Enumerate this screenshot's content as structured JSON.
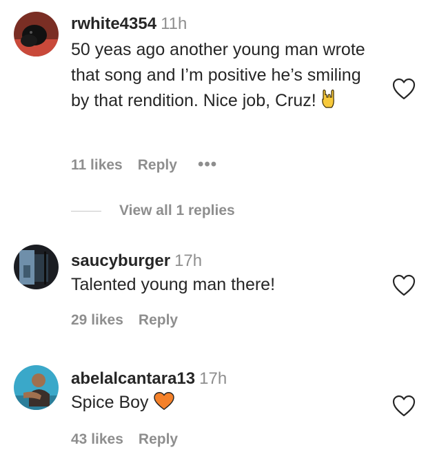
{
  "comments": [
    {
      "username": "rwhite4354",
      "time": "11h",
      "text": "50 yeas ago another young man wrote that song and I’m positive he’s smiling by that rendition. Nice job, Cruz!",
      "emoji_icon": "rock-hand-emoji-icon",
      "likes": "11 likes",
      "reply": "Reply",
      "more": "•••"
    },
    {
      "username": "saucyburger",
      "time": "17h",
      "text": "Talented young man there!",
      "likes": "29 likes",
      "reply": "Reply"
    },
    {
      "username": "abelalcantara13",
      "time": "17h",
      "text": "Spice Boy",
      "emoji_icon": "orange-heart-emoji-icon",
      "likes": "43 likes",
      "reply": "Reply"
    }
  ],
  "view_replies": "View all 1 replies",
  "colors": {
    "text": "#262626",
    "muted": "#8e8e8e",
    "orange_heart": "#f4812a",
    "rock_hand": "#f7c93b"
  }
}
